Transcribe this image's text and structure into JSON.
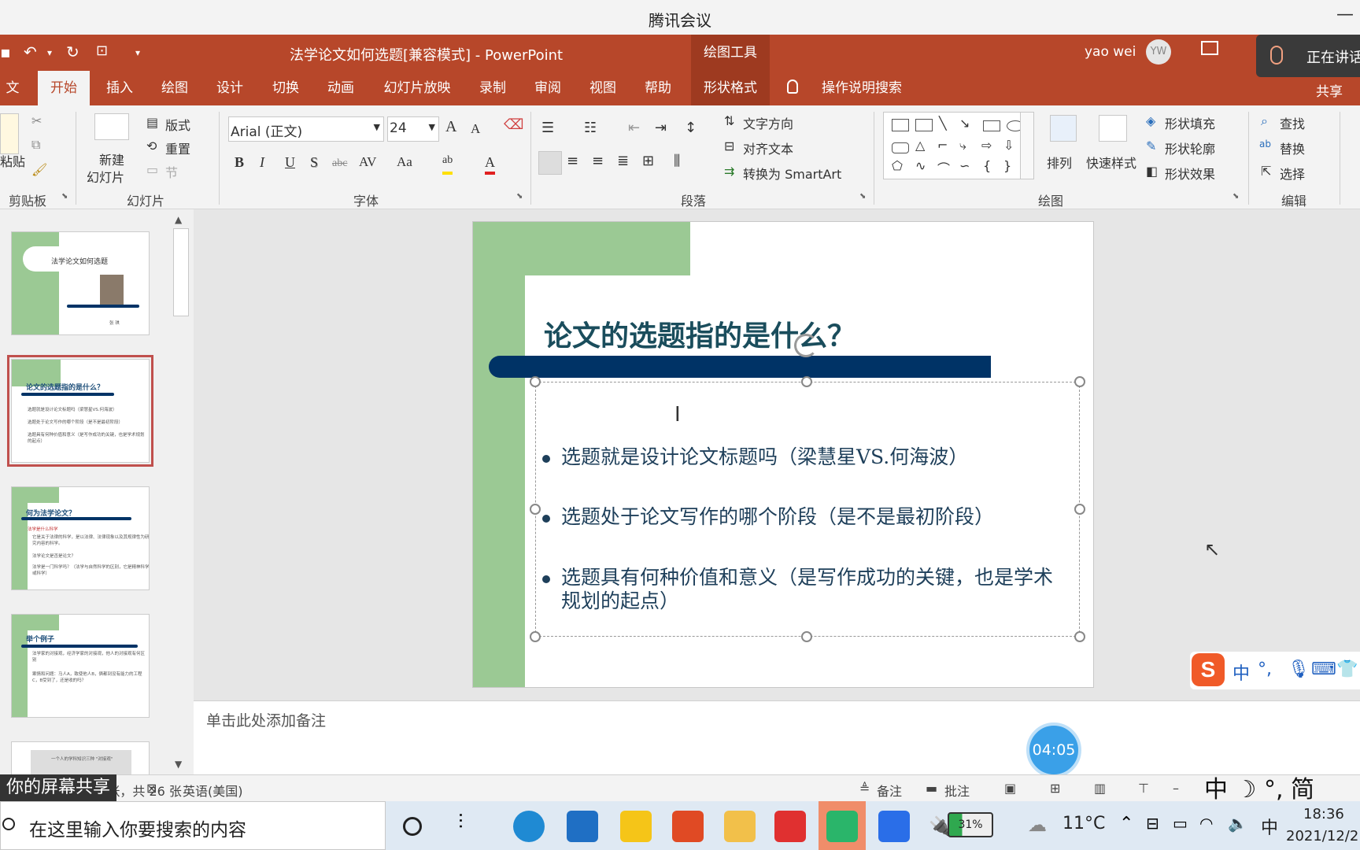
{
  "meeting": {
    "title": "腾讯会议",
    "minimize": "—",
    "speaking": "正在讲话",
    "share_label": "你的屏幕共享"
  },
  "ppt": {
    "doc_title": "法学论文如何选题[兼容模式]  -  PowerPoint",
    "drawing_tools": "绘图工具",
    "user_name": "yao wei",
    "user_initials": "YW",
    "tabs": [
      "文件",
      "开始",
      "插入",
      "绘图",
      "设计",
      "切换",
      "动画",
      "幻灯片放映",
      "录制",
      "审阅",
      "视图",
      "帮助",
      "形状格式"
    ],
    "active_tab": "开始",
    "tell_me": "操作说明搜索",
    "share": "共享"
  },
  "ribbon": {
    "clipboard": {
      "paste": "粘贴",
      "label": "剪贴板"
    },
    "slides": {
      "new_slide_1": "新建",
      "new_slide_2": "幻灯片",
      "layout": "版式",
      "reset": "重置",
      "section": "节",
      "label": "幻灯片"
    },
    "font": {
      "name": "Arial (正文)",
      "size": "24",
      "label": "字体",
      "bold": "B",
      "italic": "I",
      "underline": "U",
      "shadow": "S",
      "strike": "abc",
      "spacing": "AV",
      "case": "Aa",
      "grow": "A",
      "shrink": "A"
    },
    "paragraph": {
      "text_direction": "文字方向",
      "align_text": "对齐文本",
      "smartart": "转换为 SmartArt",
      "label": "段落"
    },
    "drawing": {
      "arrange": "排列",
      "quick_styles": "快速样式",
      "fill": "形状填充",
      "outline": "形状轮廓",
      "effects": "形状效果",
      "label": "绘图"
    },
    "editing": {
      "find": "查找",
      "replace": "替换",
      "select": "选择",
      "label": "编辑"
    }
  },
  "thumbnails": [
    {
      "title": "法学论文如何选题",
      "author": "张 琪"
    },
    {
      "title": "论文的选题指的是什么？",
      "lines": [
        "选题就是设计论文标题吗（梁慧星VS.何海波）",
        "选题处于论文写作的哪个阶段（是不是最初阶段）",
        "选题具有何种价值和意义（是写作成功的关键，也是学术规划的起点）"
      ]
    },
    {
      "title": "何为法学论文？",
      "lines": [
        "法学是什么科学",
        "它是关于法律的科学，是以法律、法律现象以及其规律性为研究内容的科学。",
        "法学论文是否是论文？",
        "法学是一门科学吗？（法学与自然科学的区别，它是精神科学或科学）"
      ]
    },
    {
      "title": "举个例子",
      "lines": [
        "法学家的对接观，经济学家的对接观，他人的对接观有何区别",
        "案情和问题：马人A，致使他人B，俩都到没有能力的工程C，B受到了，还是收的吗？"
      ]
    },
    {
      "title": "一个人的学科知识三种 \"对接观\""
    }
  ],
  "slide": {
    "title": "论文的选题指的是什么？",
    "bullets": [
      "选题就是设计论文标题吗（梁慧星VS.何海波）",
      "选题处于论文写作的哪个阶段（是不是最初阶段）",
      "选题具有何种价值和意义（是写作成功的关键，也是学术规划的起点）"
    ]
  },
  "notes_placeholder": "单击此处添加备注",
  "timer": "04:05",
  "ime": {
    "logo": "S",
    "mode": "中",
    "punct": "°,",
    "status_text": "中 ☽ °, 简"
  },
  "statusbar": {
    "slide_count": "第 2 张，共 26 张",
    "language": "英语(美国)",
    "notes": "备注",
    "comments": "批注"
  },
  "taskbar": {
    "search_placeholder": "在这里输入你要搜索的内容",
    "battery": "31%",
    "temperature": "11°C",
    "ime": "中",
    "time": "18:36",
    "date": "2021/12/2"
  }
}
